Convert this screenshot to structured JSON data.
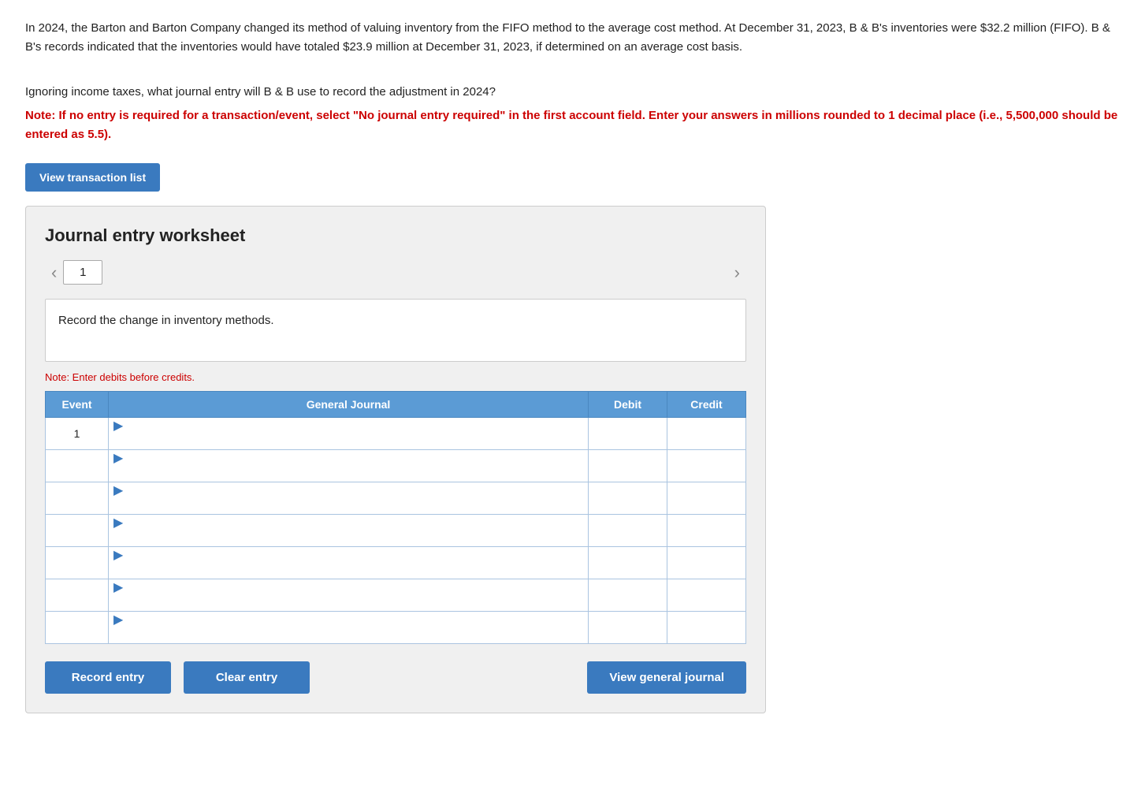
{
  "intro": {
    "paragraph1": "In 2024, the Barton and Barton Company changed its method of valuing inventory from the FIFO method to the average cost method. At December 31, 2023, B & B's inventories were $32.2 million (FIFO). B & B's records indicated that the inventories would have totaled $23.9 million at December 31, 2023, if determined on an average cost basis.",
    "paragraph2": "Ignoring income taxes, what journal entry will B & B use to record the adjustment in 2024?",
    "note": "Note: If no entry is required for a transaction/event, select \"No journal entry required\" in the first account field. Enter your answers in millions rounded to 1 decimal place (i.e., 5,500,000 should be entered as 5.5)."
  },
  "buttons": {
    "view_transaction": "View transaction list",
    "record_entry": "Record entry",
    "clear_entry": "Clear entry",
    "view_general_journal": "View general journal"
  },
  "worksheet": {
    "title": "Journal entry worksheet",
    "current_tab": "1",
    "description": "Record the change in inventory methods.",
    "note_debits": "Note: Enter debits before credits.",
    "table": {
      "headers": {
        "event": "Event",
        "general_journal": "General Journal",
        "debit": "Debit",
        "credit": "Credit"
      },
      "rows": [
        {
          "event": "1",
          "journal": "",
          "debit": "",
          "credit": "",
          "indent": false,
          "has_arrow": true
        },
        {
          "event": "",
          "journal": "",
          "debit": "",
          "credit": "",
          "indent": true,
          "has_arrow": true
        },
        {
          "event": "",
          "journal": "",
          "debit": "",
          "credit": "",
          "indent": true,
          "has_arrow": true
        },
        {
          "event": "",
          "journal": "",
          "debit": "",
          "credit": "",
          "indent": true,
          "has_arrow": true
        },
        {
          "event": "",
          "journal": "",
          "debit": "",
          "credit": "",
          "indent": true,
          "has_arrow": true
        },
        {
          "event": "",
          "journal": "",
          "debit": "",
          "credit": "",
          "indent": true,
          "has_arrow": true
        },
        {
          "event": "",
          "journal": "",
          "debit": "",
          "credit": "",
          "indent": true,
          "has_arrow": true
        }
      ]
    }
  },
  "nav": {
    "left_arrow": "‹",
    "right_arrow": "›"
  }
}
